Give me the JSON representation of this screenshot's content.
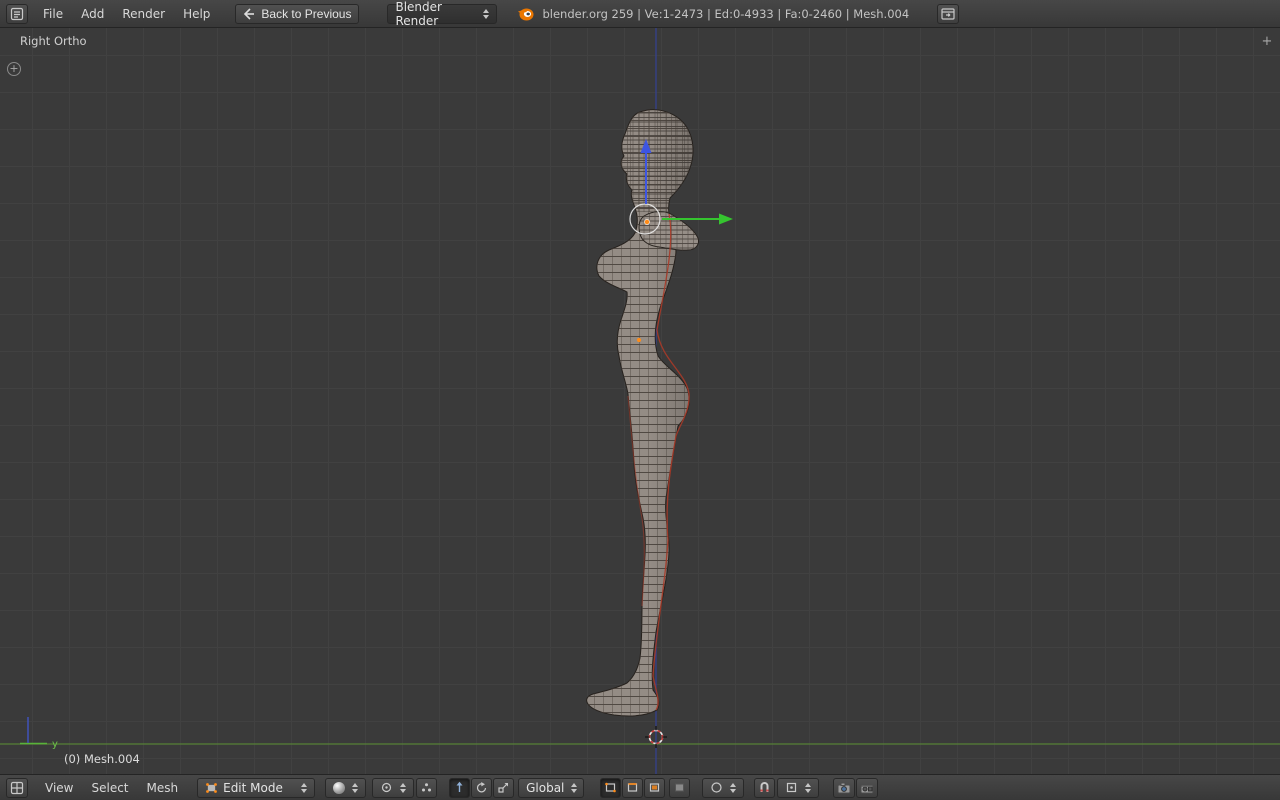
{
  "top_header": {
    "menus": [
      {
        "label": "File"
      },
      {
        "label": "Add"
      },
      {
        "label": "Render"
      },
      {
        "label": "Help"
      }
    ],
    "back_button_label": "Back to Previous",
    "engine_dropdown_value": "Blender Render",
    "status_text": "blender.org 259 | Ve:1-2473 | Ed:0-4933 | Fa:0-2460 | Mesh.004"
  },
  "viewport": {
    "view_label": "Right Ortho",
    "object_info": "(0) Mesh.004",
    "axis_gizmo_y_label": "y"
  },
  "bottom_header": {
    "menus": [
      {
        "label": "View"
      },
      {
        "label": "Select"
      },
      {
        "label": "Mesh"
      }
    ],
    "mode_dropdown_value": "Edit Mode",
    "orientation_dropdown_value": "Global"
  },
  "colors": {
    "manipulator_green": "#35c42f",
    "manipulator_blue": "#3d55e2",
    "axis_y_line": "#568036",
    "axis_z_line": "#344093",
    "origin_orange": "#ff8c19",
    "seam_red": "#a83a28",
    "blender_orange": "#ea7600"
  }
}
